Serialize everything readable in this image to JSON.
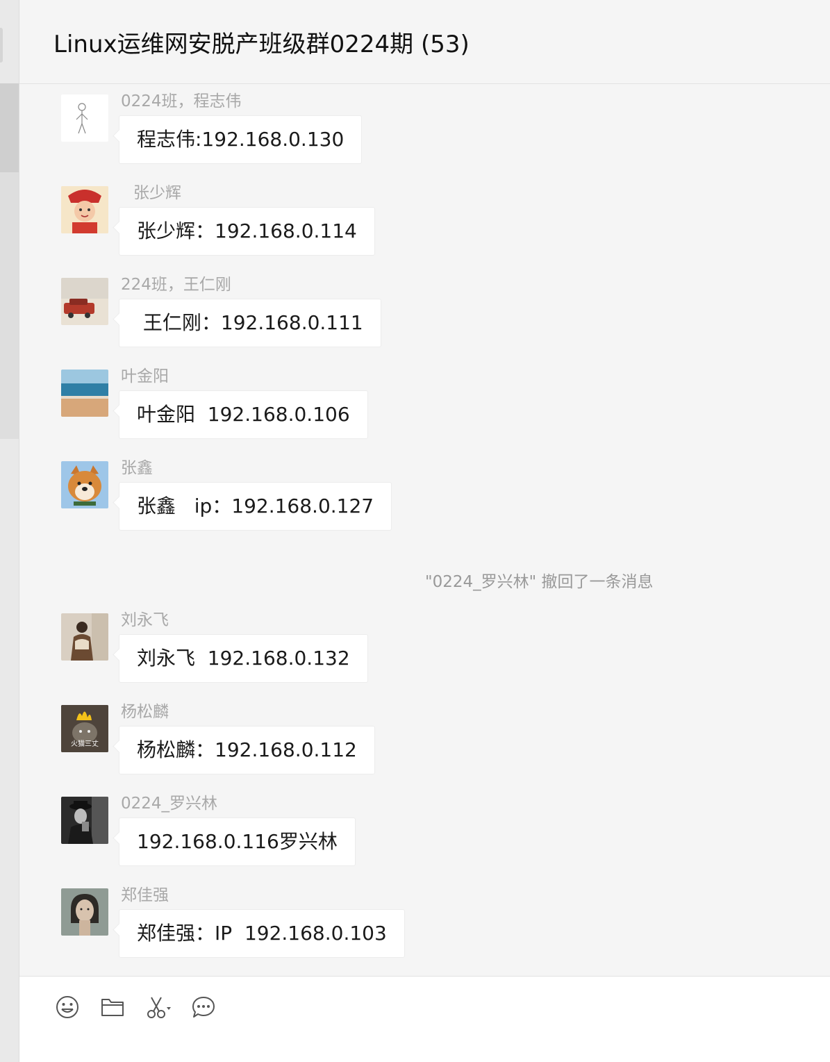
{
  "header": {
    "title": "Linux运维网安脱产班级群0224期 (53)"
  },
  "messages": [
    {
      "sender": "0224班，程志伟",
      "text": "程志伟:192.168.0.130",
      "avatar": "sketch-person-avatar"
    },
    {
      "sender": "张少辉",
      "text": "张少辉：192.168.0.114",
      "avatar": "cartoon-boy-avatar"
    },
    {
      "sender": "224班，王仁刚",
      "text": " 王仁刚：192.168.0.111",
      "avatar": "red-car-avatar"
    },
    {
      "sender": "叶金阳",
      "text": "叶金阳  192.168.0.106",
      "avatar": "beach-avatar"
    },
    {
      "sender": "张鑫",
      "text": "张鑫   ip：192.168.0.127",
      "avatar": "shiba-dog-avatar"
    },
    {
      "sender": "刘永飞",
      "text": "刘永飞  192.168.0.132",
      "avatar": "person-coat-avatar"
    },
    {
      "sender": "杨松麟",
      "text": "杨松麟：192.168.0.112",
      "avatar": "cat-fire-avatar",
      "avatar_caption": "火猫三丈"
    },
    {
      "sender": "0224_罗兴林",
      "text": "192.168.0.116罗兴林",
      "avatar": "hat-man-avatar"
    },
    {
      "sender": "郑佳强",
      "text": "郑佳强：IP  192.168.0.103",
      "avatar": "portrait-avatar"
    }
  ],
  "system_notice": "\"0224_罗兴林\" 撤回了一条消息",
  "toolbar": {
    "icons": [
      "emoji-icon",
      "folder-icon",
      "scissors-icon",
      "chat-bubble-icon"
    ]
  },
  "colors": {
    "background": "#f5f5f5",
    "bubble": "#ffffff",
    "sender_text": "#a8a8a8",
    "system_text": "#999999"
  }
}
